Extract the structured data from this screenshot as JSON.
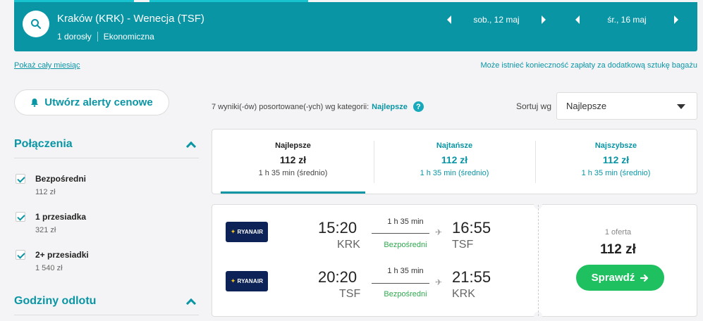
{
  "header": {
    "route": "Kraków (KRK) - Wenecja (TSF)",
    "passengers": "1 dorosły",
    "cabin": "Ekonomiczna",
    "departure_date": "sob., 12 maj",
    "return_date": "śr., 16 maj"
  },
  "links": {
    "show_month": "Pokaż cały miesiąc",
    "baggage_note": "Może istnieć konieczność zapłaty za dodatkową sztukę bagażu"
  },
  "alert_button": "Utwórz alerty cenowe",
  "sidebar": {
    "connections_title": "Połączenia",
    "filters": [
      {
        "label": "Bezpośredni",
        "price": "112 zł",
        "checked": true
      },
      {
        "label": "1 przesiadka",
        "price": "321 zł",
        "checked": true
      },
      {
        "label": "2+ przesiadki",
        "price": "1 540 zł",
        "checked": true
      }
    ],
    "departure_times_title": "Godziny odlotu"
  },
  "results": {
    "summary": "7 wyniki(-ów) posortowane(-ych) wg kategorii:",
    "category": "Najlepsze",
    "help": "?",
    "sort_label": "Sortuj wg",
    "sort_value": "Najlepsze"
  },
  "tabs": [
    {
      "title": "Najlepsze",
      "price": "112 zł",
      "duration": "1 h 35 min (średnio)",
      "active": true
    },
    {
      "title": "Najtańsze",
      "price": "112 zł",
      "duration": "1 h 35 min (średnio)",
      "active": false
    },
    {
      "title": "Najszybsze",
      "price": "112 zł",
      "duration": "1 h 35 min (średnio)",
      "active": false
    }
  ],
  "result_card": {
    "legs": [
      {
        "airline": "RYANAIR",
        "dep_time": "15:20",
        "dep_code": "KRK",
        "duration": "1 h 35 min",
        "stops": "Bezpośredni",
        "arr_time": "16:55",
        "arr_code": "TSF"
      },
      {
        "airline": "RYANAIR",
        "dep_time": "20:20",
        "dep_code": "TSF",
        "duration": "1 h 35 min",
        "stops": "Bezpośredni",
        "arr_time": "21:55",
        "arr_code": "KRK"
      }
    ],
    "offers": "1 oferta",
    "price": "112 zł",
    "cta": "Sprawdź"
  },
  "colors": {
    "brand": "#0a95a5",
    "accent_strip": "#17c3cf",
    "cta": "#1ec05f",
    "airline": "#0d2256"
  }
}
